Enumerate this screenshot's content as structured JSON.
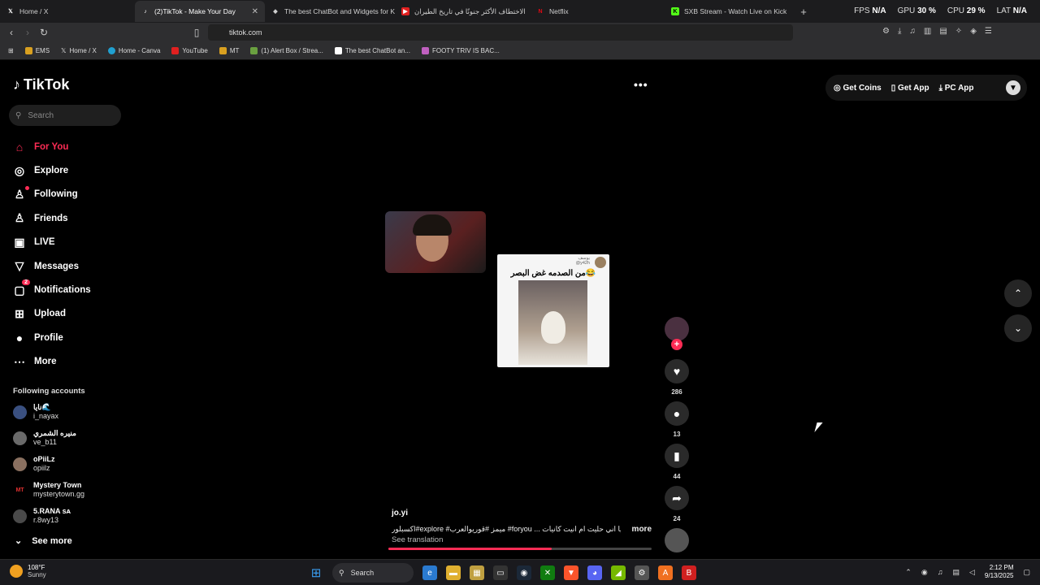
{
  "browser": {
    "tabs": [
      {
        "title": "Home / X",
        "icon": "x-icon"
      },
      {
        "title": "(2)TikTok - Make Your Day",
        "icon": "tiktok-icon",
        "active": true
      },
      {
        "title": "The best ChatBot and Widgets for Ki",
        "icon": "diamond-icon"
      },
      {
        "title": "الاختطاف الأكثر جنونًا في تاريخ الطيران",
        "icon": "youtube-icon"
      },
      {
        "title": "Netflix",
        "icon": "netflix-icon"
      },
      {
        "title": "SXB Stream - Watch Live on Kick",
        "icon": "kick-icon"
      }
    ],
    "perf": {
      "fps_label": "FPS",
      "fps": "N/A",
      "gpu_label": "GPU",
      "gpu": "30 %",
      "cpu_label": "CPU",
      "cpu": "29 %",
      "lat_label": "LAT",
      "lat": "N/A"
    },
    "url": "tiktok.com",
    "bookmarks": [
      "EMS",
      "Home / X",
      "Home - Canva",
      "YouTube",
      "MT",
      "(1) Alert Box / Strea...",
      "The best ChatBot an...",
      "FOOTY TRIV IS BAC..."
    ]
  },
  "tiktok": {
    "logo": "TikTok",
    "search_placeholder": "Search",
    "nav": [
      {
        "label": "For You",
        "icon": "home-icon",
        "glyph": "⌂"
      },
      {
        "label": "Explore",
        "icon": "compass-icon",
        "glyph": "◎"
      },
      {
        "label": "Following",
        "icon": "following-icon",
        "glyph": "♙"
      },
      {
        "label": "Friends",
        "icon": "friends-icon",
        "glyph": "♙"
      },
      {
        "label": "LIVE",
        "icon": "live-icon",
        "glyph": "▣"
      },
      {
        "label": "Messages",
        "icon": "messages-icon",
        "glyph": "▽"
      },
      {
        "label": "Notifications",
        "icon": "bell-icon",
        "glyph": "▢",
        "badge": "2"
      },
      {
        "label": "Upload",
        "icon": "upload-icon",
        "glyph": "⊞"
      },
      {
        "label": "Profile",
        "icon": "profile-icon",
        "glyph": "●"
      },
      {
        "label": "More",
        "icon": "more-icon",
        "glyph": "⋯"
      }
    ],
    "following_title": "Following accounts",
    "following": [
      {
        "name": "نايا🌊",
        "handle": "i_nayax"
      },
      {
        "name": "منيره الشمري",
        "handle": "ve_b11"
      },
      {
        "name": "oPiiLz",
        "handle": "opiilz"
      },
      {
        "name": "Mystery Town",
        "handle": "mysterytown.gg"
      },
      {
        "name": "5.RANA ѕᴀ",
        "handle": "r.8wy13"
      }
    ],
    "see_more": "See more",
    "header_buttons": {
      "coins": "Get Coins",
      "app": "Get App",
      "pc": "PC App"
    },
    "post": {
      "overlay_handle": "يوسف",
      "overlay_sub": "@y42h",
      "overlay_caption": "من الصدمه غض البصر😂"
    },
    "actions": {
      "likes": "286",
      "comments": "13",
      "saves": "44",
      "shares": "24"
    },
    "video": {
      "username": "jo.yi",
      "description": "اكسبلور#explore #ميمز #قوريوالعرب #foryou ... والله يا اني حليت ام انيت كانيات",
      "more": "more",
      "see_translation": "See translation",
      "progress": 0.62
    }
  },
  "taskbar": {
    "temp": "108°F",
    "weather": "Sunny",
    "search": "Search",
    "time": "2:12 PM",
    "date": "9/13/2025"
  }
}
